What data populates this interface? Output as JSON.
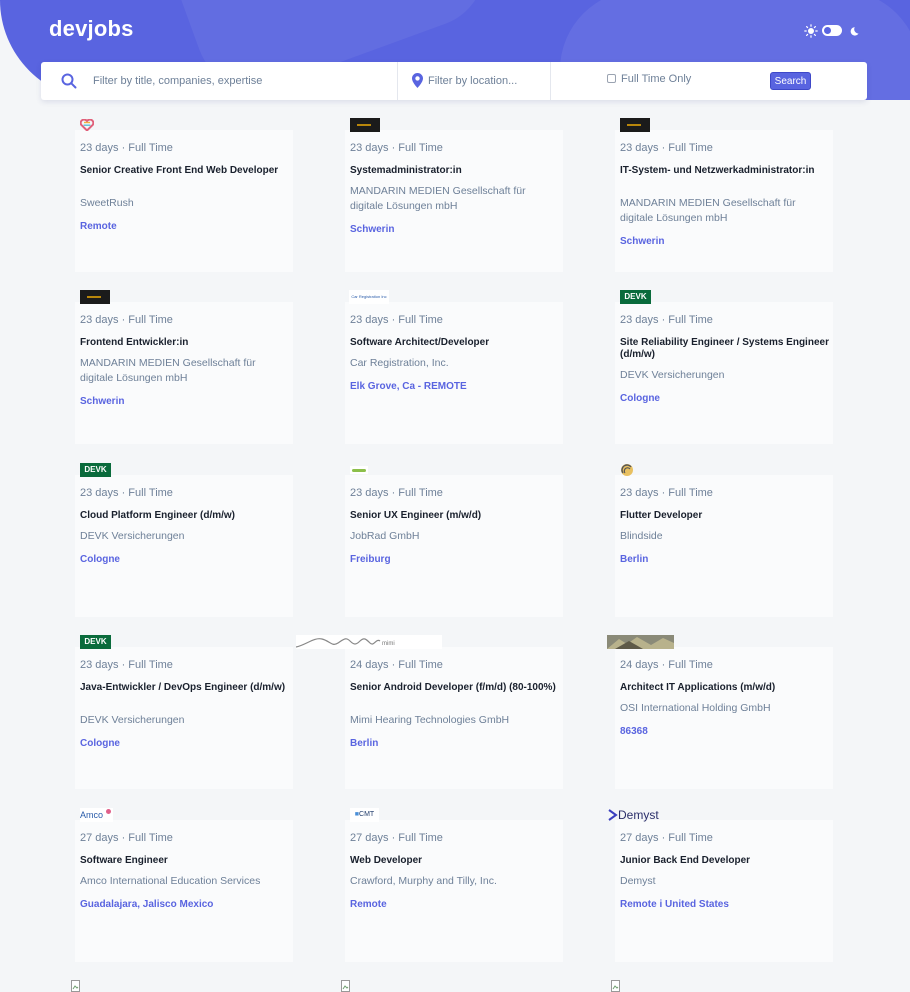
{
  "header": {
    "logo": "devjobs",
    "colors": {
      "accent": "#5964e0",
      "background": "#f4f6f8",
      "title": "#19202d",
      "muted": "#6e8098"
    }
  },
  "search": {
    "title_placeholder": "Filter by title, companies, expertise",
    "location_placeholder": "Filter by location...",
    "fulltime_label": "Full Time Only",
    "button_label": "Search"
  },
  "jobs": [
    {
      "logo": "sweetrush-heart-logo",
      "meta": "23 days · Full Time",
      "title": "Senior Creative Front End Web Developer",
      "company": "SweetRush",
      "location": "Remote"
    },
    {
      "logo": "mandarin-logo",
      "meta": "23 days · Full Time",
      "title": "Systemadministrator:in",
      "company": "MANDARIN MEDIEN Gesellschaft für digitale Lösungen mbH",
      "location": "Schwerin"
    },
    {
      "logo": "mandarin-logo",
      "meta": "23 days · Full Time",
      "title": "IT-System- und Netzwerkadministrator:in",
      "company": "MANDARIN MEDIEN Gesellschaft für digitale Lösungen mbH",
      "location": "Schwerin"
    },
    {
      "logo": "mandarin-logo",
      "meta": "23 days · Full Time",
      "title": "Frontend Entwickler:in",
      "company": "MANDARIN MEDIEN Gesellschaft für digitale Lösungen mbH",
      "location": "Schwerin"
    },
    {
      "logo": "car-registration-logo",
      "meta": "23 days · Full Time",
      "title": "Software Architect/Developer",
      "company": "Car Registration, Inc.",
      "location": "Elk Grove, Ca - REMOTE"
    },
    {
      "logo": "devk-logo",
      "meta": "23 days · Full Time",
      "title": "Site Reliability Engineer / Systems Engineer (d/m/w)",
      "company": "DEVK Versicherungen",
      "location": "Cologne"
    },
    {
      "logo": "devk-logo",
      "meta": "23 days · Full Time",
      "title": "Cloud Platform Engineer (d/m/w)",
      "company": "DEVK Versicherungen",
      "location": "Cologne"
    },
    {
      "logo": "jobrad-logo",
      "meta": "23 days · Full Time",
      "title": "Senior UX Engineer (m/w/d)",
      "company": "JobRad GmbH",
      "location": "Freiburg"
    },
    {
      "logo": "blindside-logo",
      "meta": "23 days · Full Time",
      "title": "Flutter Developer",
      "company": "Blindside",
      "location": "Berlin"
    },
    {
      "logo": "devk-logo",
      "meta": "23 days · Full Time",
      "title": "Java-Entwickler / DevOps Engineer (d/m/w)",
      "company": "DEVK Versicherungen",
      "location": "Cologne"
    },
    {
      "logo": "mimi-waveform-logo",
      "meta": "24 days · Full Time",
      "title": "Senior Android Developer (f/m/d) (80-100%)",
      "company": "Mimi Hearing Technologies GmbH",
      "location": "Berlin"
    },
    {
      "logo": "osi-photo-logo",
      "meta": "24 days · Full Time",
      "title": "Architect IT Applications (m/w/d)",
      "company": "OSI International Holding GmbH",
      "location": "86368"
    },
    {
      "logo": "amco-logo",
      "meta": "27 days · Full Time",
      "title": "Software Engineer",
      "company": "Amco International Education Services",
      "location": "Guadalajara, Jalisco Mexico"
    },
    {
      "logo": "cmt-logo",
      "meta": "27 days · Full Time",
      "title": "Web Developer",
      "company": "Crawford, Murphy and Tilly, Inc.",
      "location": "Remote"
    },
    {
      "logo": "demyst-logo",
      "meta": "27 days · Full Time",
      "title": "Junior Back End Developer",
      "company": "Demyst",
      "location": "Remote i United States"
    }
  ],
  "logo_text": {
    "devk": "DEVK",
    "amco": "Amco",
    "cmt": "CMT",
    "demyst": "Demyst",
    "mimi": "mimi",
    "car_registration": "Car Registration Inc"
  }
}
